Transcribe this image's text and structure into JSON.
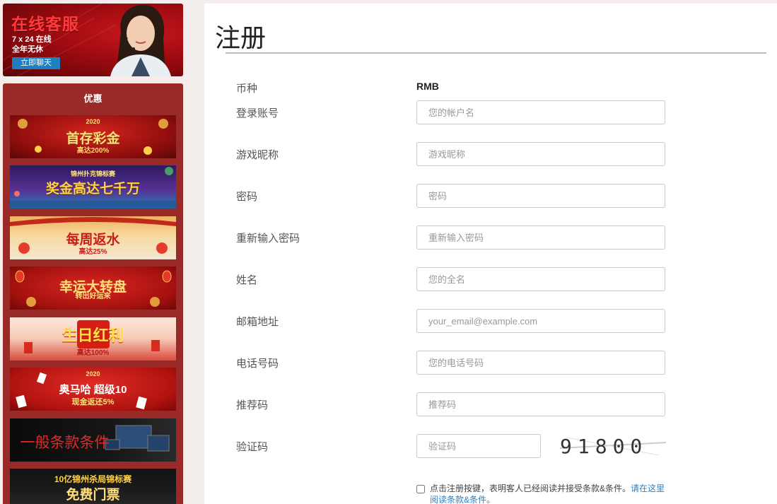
{
  "support": {
    "title": "在线客服",
    "line1": "7 x 24 在线",
    "line2": "全年无休",
    "chat_button": "立即聊天"
  },
  "promotions": {
    "title": "优惠",
    "banners": [
      {
        "tag": "2020",
        "main": "首存彩金",
        "sub": "高达200%"
      },
      {
        "tag": "锦州扑克锦标赛",
        "main": "奖金高达七千万",
        "sub": ""
      },
      {
        "tag": "",
        "main": "每周返水",
        "sub": "高达25%"
      },
      {
        "tag": "",
        "main": "幸运大转盘",
        "sub": "转出好运来"
      },
      {
        "tag": "",
        "main": "生日红利",
        "sub": "高达100%"
      },
      {
        "tag": "2020",
        "main": "奥马哈  超级10",
        "sub": "现金返还5%"
      },
      {
        "tag": "",
        "main": "一般条款条件",
        "sub": ""
      },
      {
        "tag": "10亿锦州杀局锦标赛",
        "main": "免费门票",
        "sub": ""
      }
    ]
  },
  "form": {
    "title": "注册",
    "currency_label": "币种",
    "currency_value": "RMB",
    "fields": [
      {
        "label": "登录账号",
        "placeholder": "您的帐户名"
      },
      {
        "label": "游戏昵称",
        "placeholder": "游戏昵称"
      },
      {
        "label": "密码",
        "placeholder": "密码"
      },
      {
        "label": "重新输入密码",
        "placeholder": "重新输入密码"
      },
      {
        "label": "姓名",
        "placeholder": "您的全名"
      },
      {
        "label": "邮箱地址",
        "placeholder": "your_email@example.com"
      },
      {
        "label": "电话号码",
        "placeholder": "您的电话号码"
      },
      {
        "label": "推荐码",
        "placeholder": "推荐码"
      }
    ],
    "captcha_label": "验证码",
    "captcha_placeholder": "验证码",
    "captcha_text": "91800",
    "terms_text": "点击注册按键，表明客人已经阅读并接受条款&条件。",
    "terms_link": "请在这里阅读条款&条件。"
  }
}
